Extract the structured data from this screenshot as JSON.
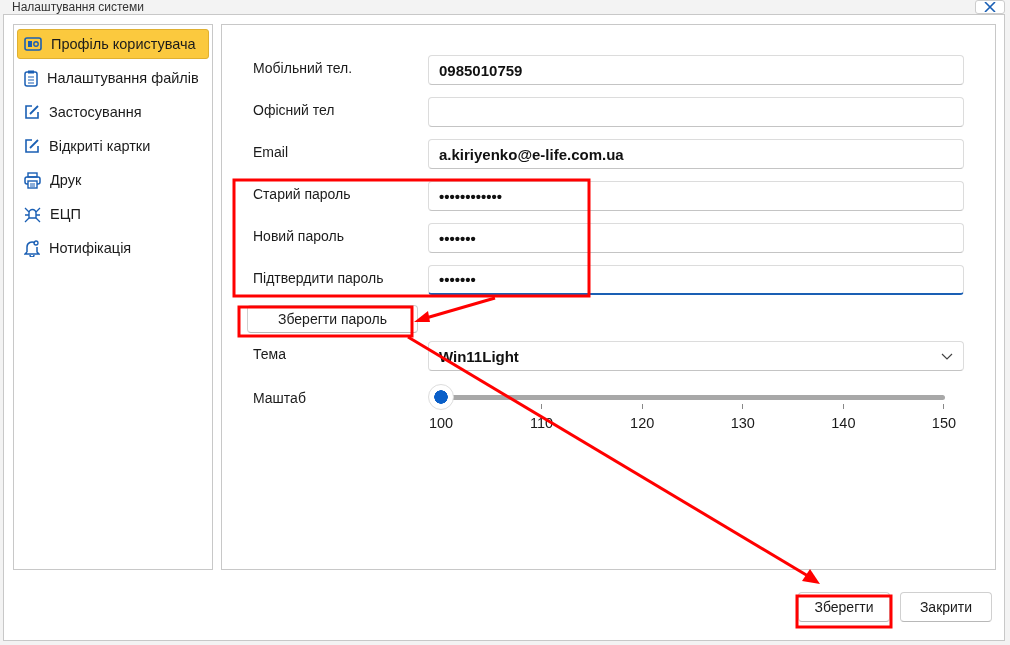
{
  "window": {
    "title": "Налаштування системи"
  },
  "sidebar": {
    "items": [
      {
        "label": "Профіль користувача",
        "kind": "profile",
        "selected": true
      },
      {
        "label": "Налаштування файлів",
        "kind": "clipboard",
        "selected": false
      },
      {
        "label": "Застосування",
        "kind": "edit",
        "selected": false
      },
      {
        "label": "Відкриті картки",
        "kind": "edit",
        "selected": false
      },
      {
        "label": "Друк",
        "kind": "printer",
        "selected": false
      },
      {
        "label": "ЕЦП",
        "kind": "bug",
        "selected": false
      },
      {
        "label": "Нотифікація",
        "kind": "bell",
        "selected": false
      }
    ]
  },
  "form": {
    "fields": [
      {
        "label": "Мобільний тел.",
        "value": "0985010759",
        "focused": false
      },
      {
        "label": "Офісний тел",
        "focused": false
      },
      {
        "label": "Email",
        "value": "a.kiriyenko@e-life.com.ua",
        "focused": false
      },
      {
        "label": "Старий пароль",
        "value": "••••••••••••",
        "focused": false
      },
      {
        "label": "Новий пароль",
        "value": "•••••••",
        "focused": false
      },
      {
        "label": "Підтвердити пароль",
        "value": "•••••••",
        "focused": true
      }
    ],
    "save_password_button": "Зберегти пароль",
    "theme": {
      "label": "Тема",
      "value": "Win11Light"
    },
    "scale": {
      "label": "Маштаб",
      "level": 0,
      "ticks": [
        "100",
        "110",
        "120",
        "130",
        "140",
        "150"
      ]
    }
  },
  "buttons": [
    "Зберегти",
    "Закрити"
  ]
}
